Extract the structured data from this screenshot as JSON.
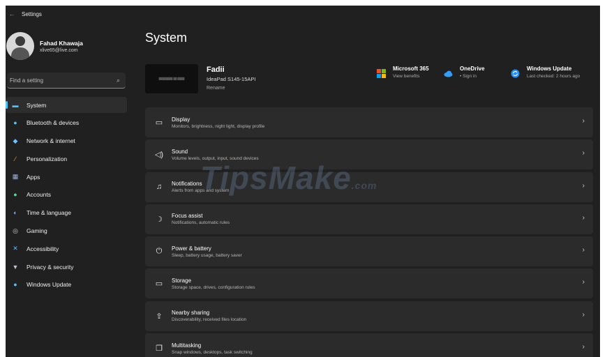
{
  "window": {
    "title": "Settings"
  },
  "profile": {
    "name": "Fahad Khawaja",
    "email": "xlive65@live.com"
  },
  "search": {
    "placeholder": "Find a setting"
  },
  "nav": {
    "items": [
      {
        "label": "System",
        "icon": "monitor-icon",
        "selected": true
      },
      {
        "label": "Bluetooth & devices",
        "icon": "bluetooth-icon"
      },
      {
        "label": "Network & internet",
        "icon": "wifi-icon"
      },
      {
        "label": "Personalization",
        "icon": "brush-icon"
      },
      {
        "label": "Apps",
        "icon": "apps-icon"
      },
      {
        "label": "Accounts",
        "icon": "person-icon"
      },
      {
        "label": "Time & language",
        "icon": "globe-icon"
      },
      {
        "label": "Gaming",
        "icon": "controller-icon"
      },
      {
        "label": "Accessibility",
        "icon": "accessibility-icon"
      },
      {
        "label": "Privacy & security",
        "icon": "shield-icon"
      },
      {
        "label": "Windows Update",
        "icon": "update-icon"
      }
    ]
  },
  "main": {
    "title": "System",
    "device": {
      "name": "Fadii",
      "model": "IdeaPad S145-15API",
      "rename": "Rename"
    },
    "quick": [
      {
        "title": "Microsoft 365",
        "sub": "View benefits",
        "icon": "microsoft-365-icon"
      },
      {
        "title": "OneDrive",
        "sub": "• Sign in",
        "icon": "onedrive-icon"
      },
      {
        "title": "Windows Update",
        "sub": "Last checked: 2 hours ago",
        "icon": "windows-update-icon"
      }
    ],
    "cards": [
      {
        "title": "Display",
        "sub": "Monitors, brightness, night light, display profile",
        "icon": "display-icon"
      },
      {
        "title": "Sound",
        "sub": "Volume levels, output, input, sound devices",
        "icon": "speaker-icon"
      },
      {
        "title": "Notifications",
        "sub": "Alerts from apps and system",
        "icon": "bell-icon"
      },
      {
        "title": "Focus assist",
        "sub": "Notifications, automatic rules",
        "icon": "moon-icon"
      },
      {
        "title": "Power & battery",
        "sub": "Sleep, battery usage, battery saver",
        "icon": "power-icon"
      },
      {
        "title": "Storage",
        "sub": "Storage space, drives, configuration rules",
        "icon": "storage-icon"
      },
      {
        "title": "Nearby sharing",
        "sub": "Discoverability, received files location",
        "icon": "share-icon"
      },
      {
        "title": "Multitasking",
        "sub": "Snap windows, desktops, task switching",
        "icon": "multitasking-icon"
      }
    ]
  },
  "watermark": {
    "text": "TipsMake",
    "suffix": ".com"
  },
  "colors": {
    "accent": "#4cc2ff",
    "background": "#202020",
    "card": "#2b2b2b"
  }
}
